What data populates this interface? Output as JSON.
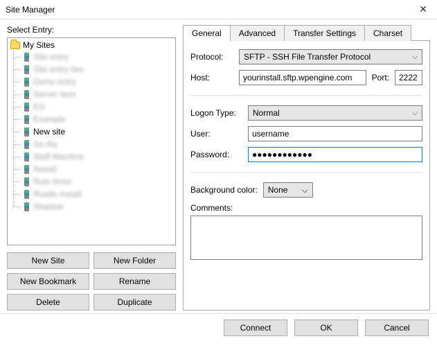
{
  "window": {
    "title": "Site Manager"
  },
  "left": {
    "label": "Select Entry:",
    "root": "My Sites",
    "items": [
      {
        "label": "Site entry",
        "blurred": true
      },
      {
        "label": "Site entry two",
        "blurred": true
      },
      {
        "label": "Demo entry",
        "blurred": true
      },
      {
        "label": "Server item",
        "blurred": true
      },
      {
        "label": "EG",
        "blurred": true
      },
      {
        "label": "Example",
        "blurred": true
      },
      {
        "label": "New site",
        "blurred": false
      },
      {
        "label": "Go Aly",
        "blurred": true
      },
      {
        "label": "Staff Machine",
        "blurred": true
      },
      {
        "label": "Aeed2",
        "blurred": true
      },
      {
        "label": "Rule three",
        "blurred": true
      },
      {
        "label": "Roads Install",
        "blurred": true
      },
      {
        "label": "Shadow",
        "blurred": true
      }
    ],
    "buttons": {
      "new_site": "New Site",
      "new_folder": "New Folder",
      "new_bookmark": "New Bookmark",
      "rename": "Rename",
      "delete": "Delete",
      "duplicate": "Duplicate"
    }
  },
  "tabs": {
    "general": "General",
    "advanced": "Advanced",
    "transfer": "Transfer Settings",
    "charset": "Charset"
  },
  "form": {
    "protocol_label": "Protocol:",
    "protocol_value": "SFTP - SSH File Transfer Protocol",
    "host_label": "Host:",
    "host_value": "yourinstall.sftp.wpengine.com",
    "port_label": "Port:",
    "port_value": "2222",
    "logon_label": "Logon Type:",
    "logon_value": "Normal",
    "user_label": "User:",
    "user_value": "username",
    "password_label": "Password:",
    "password_value": "●●●●●●●●●●●●",
    "bgcolor_label": "Background color:",
    "bgcolor_value": "None",
    "comments_label": "Comments:",
    "comments_value": ""
  },
  "footer": {
    "connect": "Connect",
    "ok": "OK",
    "cancel": "Cancel"
  }
}
